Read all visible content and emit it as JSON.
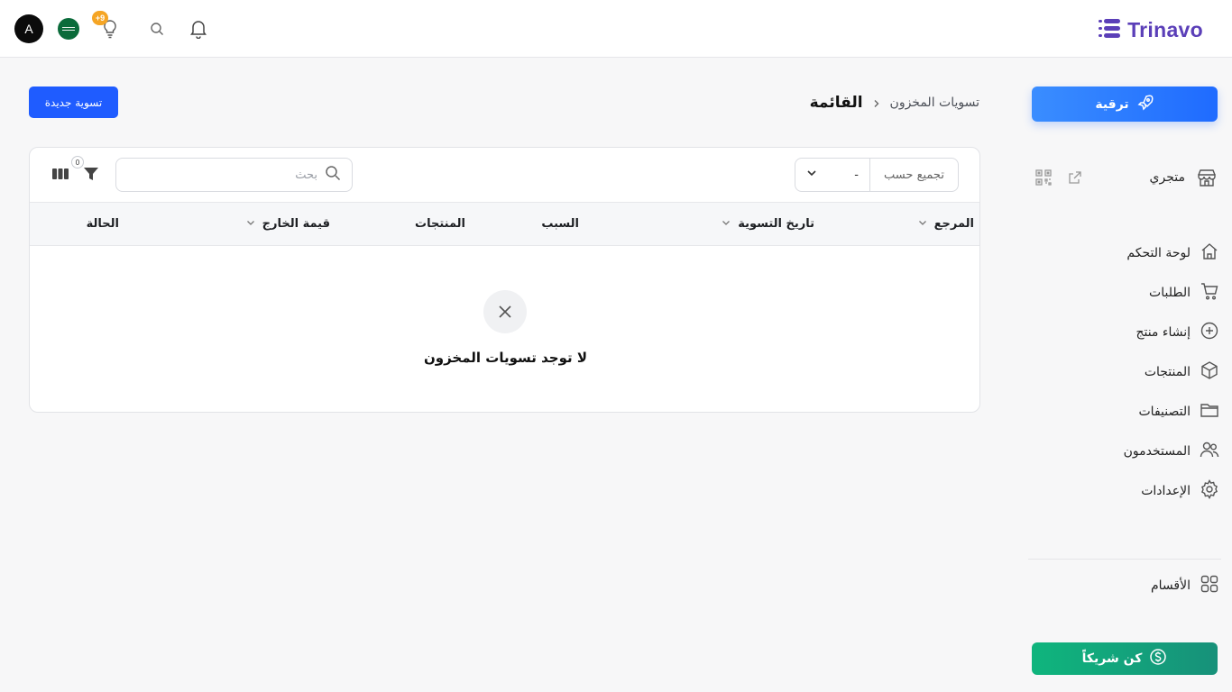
{
  "brand": {
    "name": "Trinavo"
  },
  "user": {
    "avatar_letter": "A"
  },
  "notifications": {
    "bulb_badge": "+9"
  },
  "sidebar": {
    "upgrade_label": "ترقية",
    "store_label": "متجري",
    "items": [
      {
        "label": "لوحة التحكم",
        "icon": "home-icon"
      },
      {
        "label": "الطلبات",
        "icon": "cart-icon"
      },
      {
        "label": "إنشاء منتج",
        "icon": "plus-circle-icon"
      },
      {
        "label": "المنتجات",
        "icon": "box-icon"
      },
      {
        "label": "التصنيفات",
        "icon": "folder-icon"
      },
      {
        "label": "المستخدمون",
        "icon": "users-icon"
      },
      {
        "label": "الإعدادات",
        "icon": "gear-icon"
      }
    ],
    "sections_label": "الأقسام",
    "partner_label": "كن شريكاً"
  },
  "breadcrumb": {
    "root": "تسويات المخزون",
    "current": "القائمة"
  },
  "toolbar": {
    "new_label": "تسوية جديدة",
    "group_by_label": "تجميع حسب",
    "group_by_value": "-",
    "search_placeholder": "بحث",
    "filter_count": "0"
  },
  "table": {
    "columns": [
      "المرجع",
      "تاريخ التسوية",
      "السبب",
      "المنتجات",
      "قيمة الخارج",
      "الحالة"
    ],
    "empty_text": "لا توجد تسويات المخزون"
  },
  "colors": {
    "primary": "#1f5cff",
    "brand": "#5b3fb8",
    "partner": "#0fb57d",
    "badge": "#f5a524"
  }
}
